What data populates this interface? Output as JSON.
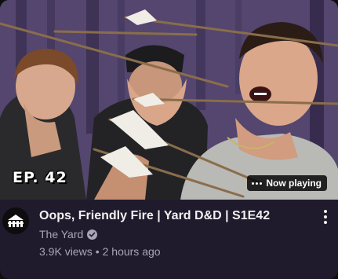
{
  "thumbnail": {
    "episode_badge": "EP. 42",
    "now_playing_label": "Now playing",
    "now_playing_icon": "playing-dots-icon"
  },
  "video": {
    "title": "Oops, Friendly Fire | Yard D&D | S1E42",
    "channel": "The Yard",
    "channel_verified": true,
    "views": "3.9K views",
    "separator": "•",
    "age": "2 hours ago"
  },
  "icons": {
    "avatar": "the-yard-logo-icon",
    "verified": "verified-check-icon",
    "more": "more-vertical-icon"
  },
  "colors": {
    "card_background": "#1f1a2c",
    "title_text": "#f1f1f1",
    "secondary_text": "#aaa4b8"
  }
}
